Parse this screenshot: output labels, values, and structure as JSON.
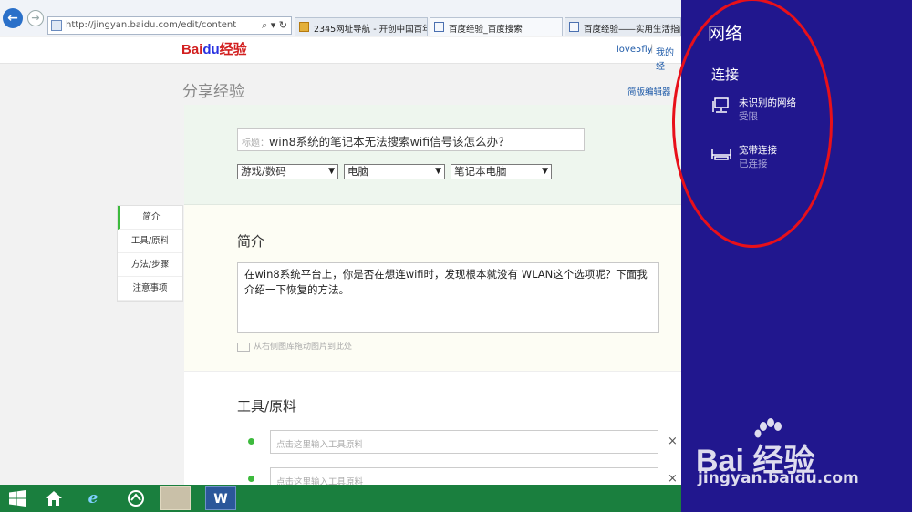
{
  "browser": {
    "url": "http://jingyan.baidu.com/edit/content",
    "addr_icons": "⌕ ▾ ↻",
    "tabs": [
      {
        "label": "2345网址导航 - 开创中国百年..."
      },
      {
        "label": "百度经验_百度搜索"
      },
      {
        "label": "百度经验——实用生活指南"
      }
    ]
  },
  "header": {
    "logo_text_a": "Bai",
    "logo_text_b": "du",
    "logo_text_c": "经验",
    "user": "love5fly",
    "separator": "|",
    "my_link": "我的经"
  },
  "page": {
    "title": "分享经验",
    "simple_editor": "简版编辑器"
  },
  "form": {
    "title_label": "标题：",
    "title_value": "win8系统的笔记本无法搜索wifi信号该怎么办？",
    "categories": [
      "游戏/数码",
      "电脑",
      "笔记本电脑"
    ]
  },
  "intro": {
    "heading": "简介",
    "text": "在win8系统平台上，你是否在想连wifi时，发现根本就没有 WLAN这个选项呢？下面我介绍一下恢复的方法。",
    "image_hint": "从右侧图库拖动图片到此处"
  },
  "tools": {
    "heading": "工具/原料",
    "placeholder": "点击这里输入工具原料",
    "remove": "×"
  },
  "leftnav": {
    "items": [
      "简介",
      "工具/原料",
      "方法/步骤",
      "注意事项"
    ]
  },
  "taskbar": {
    "ie_glyph": "e",
    "word_glyph": "W"
  },
  "network_panel": {
    "title": "网络",
    "section": "连接",
    "items": [
      {
        "name": "未识别的网络",
        "status": "受限"
      },
      {
        "name": "宽带连接",
        "status": "已连接"
      }
    ]
  },
  "watermark": {
    "logo": "Bai  经验",
    "url": "jingyan.baidu.com"
  }
}
